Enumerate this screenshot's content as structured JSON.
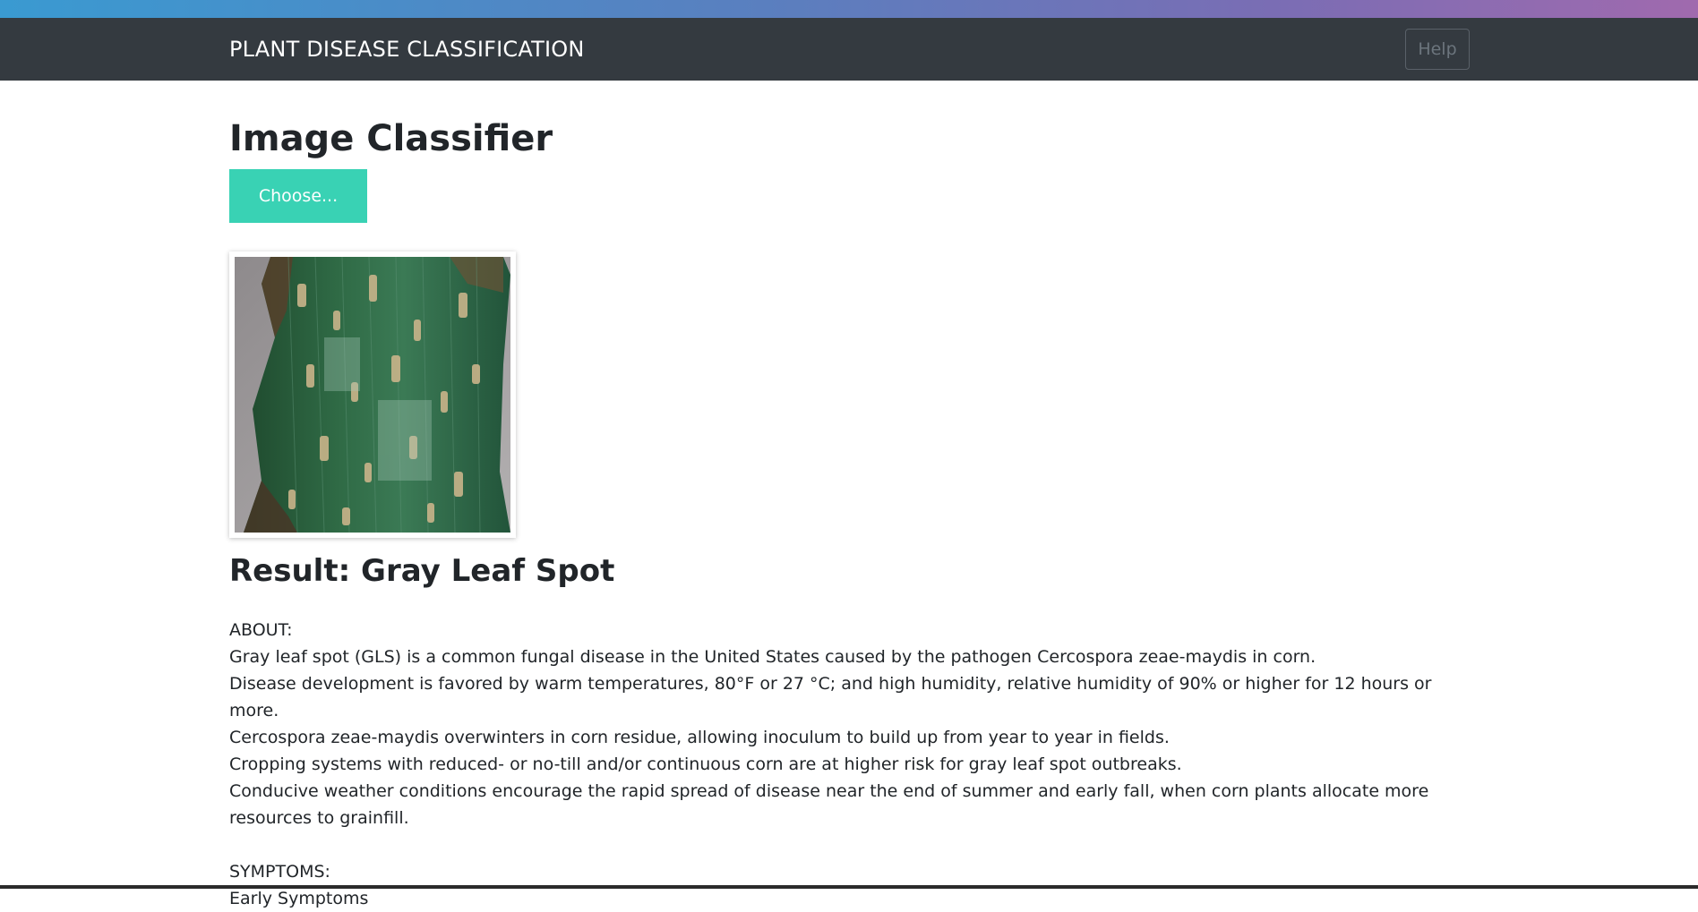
{
  "navbar": {
    "brand": "PLANT DISEASE CLASSIFICATION",
    "help_label": "Help"
  },
  "main": {
    "title": "Image Classifier",
    "choose_label": "Choose...",
    "result_prefix": "Result: ",
    "result_value": "Gray Leaf Spot",
    "about_heading": "ABOUT:",
    "about_lines": [
      "Gray leaf spot (GLS) is a common fungal disease in the United States caused by the pathogen Cercospora zeae-maydis in corn.",
      "Disease development is favored by warm temperatures, 80°F or 27 °C; and high humidity, relative humidity of 90% or higher for 12 hours or more.",
      "Cercospora zeae-maydis overwinters in corn residue, allowing inoculum to build up from year to year in fields.",
      "Cropping systems with reduced- or no-till and/or continuous corn are at higher risk for gray leaf spot outbreaks.",
      "Conducive weather conditions encourage the rapid spread of disease near the end of summer and early fall, when corn plants allocate more resources to grainfill."
    ],
    "symptoms_heading": "SYMPTOMS:",
    "symptoms_lines": [
      "Early Symptoms"
    ]
  },
  "colors": {
    "navbar_bg": "#343a40",
    "accent_button": "#39d2b4",
    "text": "#212529"
  }
}
